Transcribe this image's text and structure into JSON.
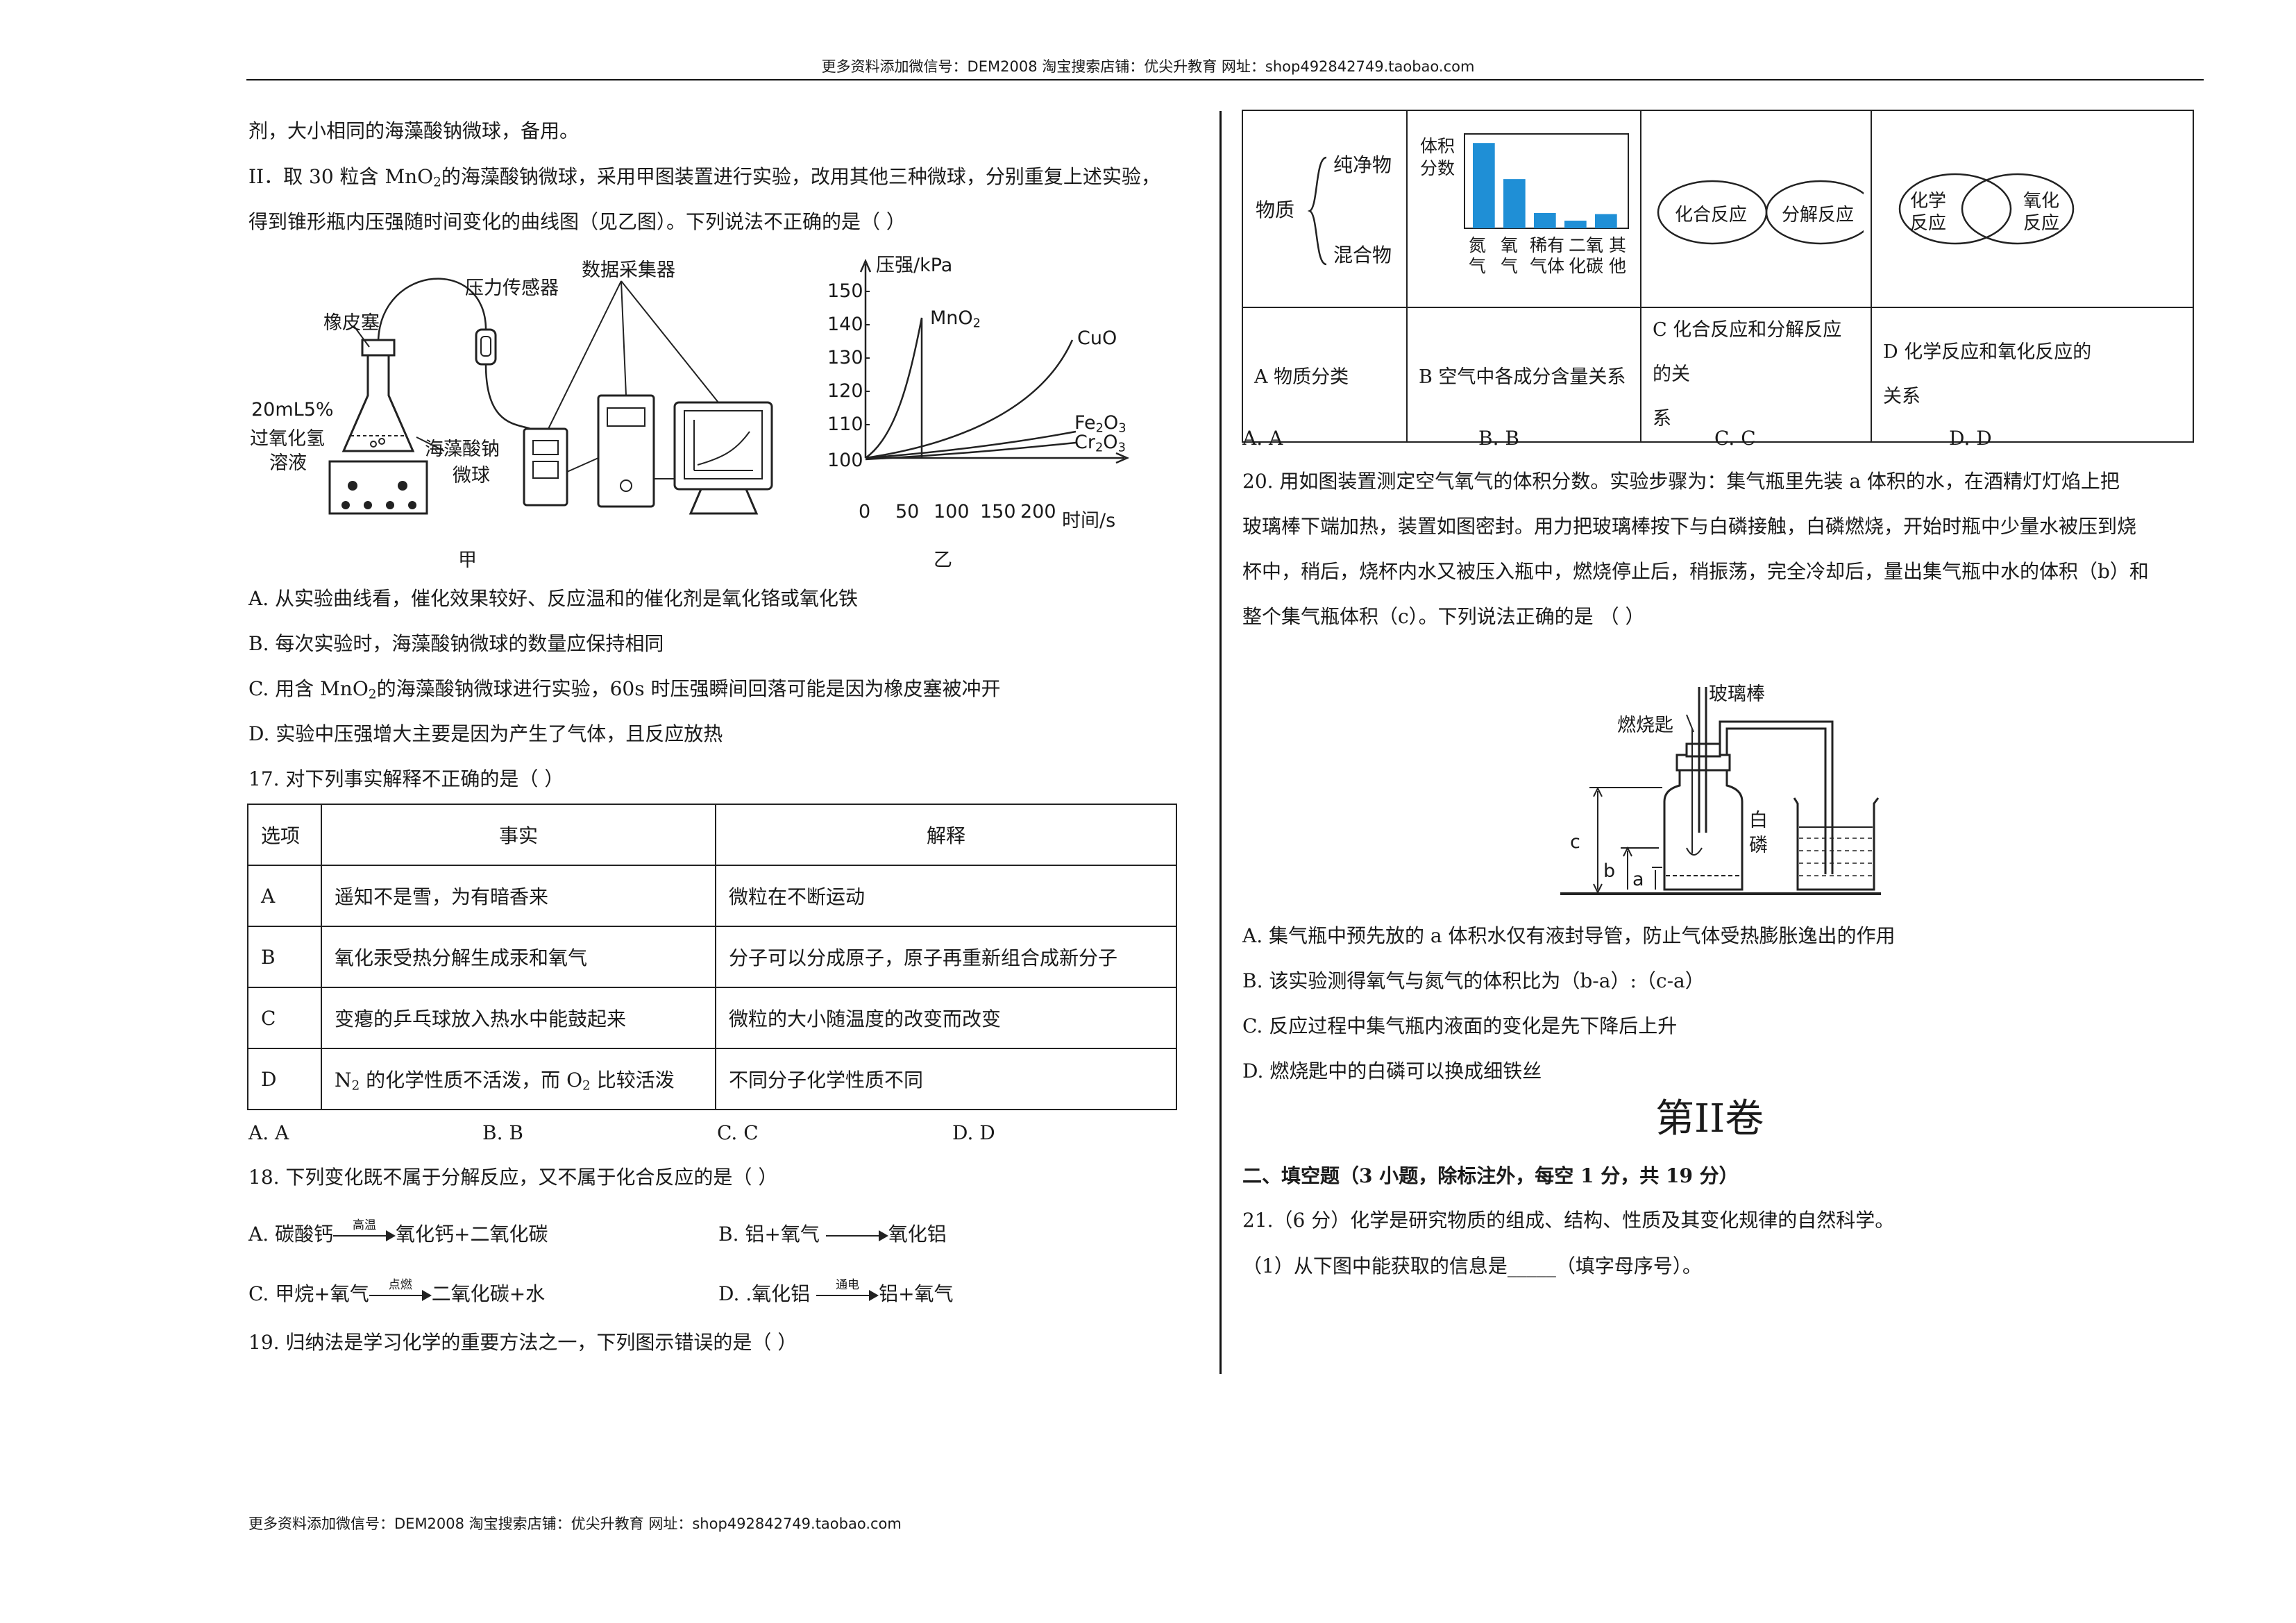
{
  "header": {
    "text": "更多资料添加微信号：DEM2008   淘宝搜索店铺：优尖升教育  网址：shop492842749.taobao.com"
  },
  "footer": {
    "text": "更多资料添加微信号：DEM2008   淘宝搜索店铺：优尖升教育  网址：shop492842749.taobao.com"
  },
  "left": {
    "cont_line": "剂，大小相同的海藻酸钠微球，备用。",
    "q16_step_a": "II．取 30 粒含 MnO",
    "q16_step_b": "的海藻酸钠微球，采用甲图装置进行实验，改用其他三种微球，分别重复上述实验，",
    "q16_step2": "得到锥形瓶内压强随时间变化的曲线图（见乙图）。下列说法不正确的是（      ）",
    "fig_jia": {
      "stopper": "橡皮塞",
      "sensor": "压力传感器",
      "collector": "数据采集器",
      "solution1": "20mL5%",
      "solution2": "过氧化氢",
      "solution3": "溶液",
      "beads1": "海藻酸钠",
      "beads2": "微球",
      "caption": "甲"
    },
    "fig_yi": {
      "ylabel": "压强/kPa",
      "xlabel": "时间/s",
      "yticks": [
        "150",
        "140",
        "130",
        "120",
        "110",
        "100"
      ],
      "xticks": [
        "0",
        "50",
        "100",
        "150",
        "200"
      ],
      "s1": "MnO",
      "s2": "CuO",
      "s3": "Fe",
      "s4": "Cr",
      "caption": "乙"
    },
    "q16_A": "A. 从实验曲线看，催化效果较好、反应温和的催化剂是氧化铬或氧化铁",
    "q16_B": "B. 每次实验时，海藻酸钠微球的数量应保持相同",
    "q16_C_a": "C. 用含 MnO",
    "q16_C_b": "的海藻酸钠微球进行实验，60s 时压强瞬间回落可能是因为橡皮塞被冲开",
    "q16_D": "D. 实验中压强增大主要是因为产生了气体，且反应放热",
    "q17": "17. 对下列事实解释不正确的是（      ）",
    "t17_h1": "选项",
    "t17_h2": "事实",
    "t17_h3": "解释",
    "t17_r1_1": "A",
    "t17_r1_2": "遥知不是雪，为有暗香来",
    "t17_r1_3": "微粒在不断运动",
    "t17_r2_1": "B",
    "t17_r2_2": "氧化汞受热分解生成汞和氧气",
    "t17_r2_3": "分子可以分成原子，原子再重新组合成新分子",
    "t17_r3_1": "C",
    "t17_r3_2": "变瘪的乒乓球放入热水中能鼓起来",
    "t17_r3_3": "微粒的大小随温度的改变而改变",
    "t17_r4_1": "D",
    "t17_r4_2a": "N",
    "t17_r4_2b": " 的化学性质不活泼，而 O",
    "t17_r4_2c": " 比较活泼",
    "t17_r4_3": "不同分子化学性质不同",
    "q17_opts": [
      "A. A",
      "B. B",
      "C. C",
      "D. D"
    ],
    "q18": "18. 下列变化既不属于分解反应，又不属于化合反应的是（         ）",
    "q18_A_a": "A. 碳酸钙",
    "q18_A_c": "高温",
    "q18_A_b": "氧化钙+二氧化碳",
    "q18_B_a": "B. 铝+氧气",
    "q18_B_b": "氧化铝",
    "q18_C_a": "C. 甲烷+氧气",
    "q18_C_c": "点燃",
    "q18_C_b": "二氧化碳+水",
    "q18_D_a": "D. .氧化铝",
    "q18_D_c": "通电",
    "q18_D_b": "铝+氧气",
    "q19": "19. 归纳法是学习化学的重要方法之一，下列图示错误的是（      ）"
  },
  "right": {
    "t19": {
      "a_label": "物质",
      "a_pure": "纯净物",
      "a_mix": "混合物",
      "b_ylabel1": "体积",
      "b_ylabel2": "分数",
      "b_cats": [
        "氮气",
        "氧气",
        "稀有气体",
        "二氧化碳",
        "其他"
      ],
      "b_values": [
        78,
        45,
        14,
        7,
        13
      ],
      "c_left": "化合反应",
      "c_right": "分解反应",
      "d_left1": "化学",
      "d_left2": "反应",
      "d_right1": "氧化",
      "d_right2": "反应",
      "row2_a": "A 物质分类",
      "row2_b": "B 空气中各成分含量关系",
      "row2_c1": "C 化合反应和分解反应的关",
      "row2_c2": "系",
      "row2_d1": "D 化学反应和氧化反应的",
      "row2_d2": "关系"
    },
    "q19_opts": [
      "A. A",
      "B. B",
      "C. C",
      "D. D"
    ],
    "q20_l1": "20. 用如图装置测定空气氧气的体积分数。实验步骤为：集气瓶里先装 a 体积的水，在酒精灯灯焰上把",
    "q20_l2": "玻璃棒下端加热，装置如图密封。用力把玻璃棒按下与白磷接触，白磷燃烧，开始时瓶中少量水被压到烧",
    "q20_l3": "杯中，稍后，烧杯内水又被压入瓶中，燃烧停止后，稍振荡，完全冷却后，量出集气瓶中水的体积（b）和",
    "q20_l4": "整个集气瓶体积（c）。下列说法正确的是 （      ）",
    "fig20": {
      "rod": "玻璃棒",
      "spoon": "燃烧匙",
      "p1": "白",
      "p2": "磷",
      "c": "c",
      "b": "b",
      "a": "a"
    },
    "q20_A": "A. 集气瓶中预先放的 a 体积水仅有液封导管，防止气体受热膨胀逸出的作用",
    "q20_B": "B. 该实验测得氧气与氮气的体积比为（b-a）:（c-a）",
    "q20_C": "C. 反应过程中集气瓶内液面的变化是先下降后上升",
    "q20_D": "D. 燃烧匙中的白磷可以换成细铁丝",
    "vol2": "第II卷",
    "sec2": "二、填空题（3 小题，除标注外，每空 1 分，共 19 分）",
    "q21": "21.（6 分）化学是研究物质的组成、结构、性质及其变化规律的自然科学。",
    "q21_1": "（1）从下图中能获取的信息是_____（填字母序号）。"
  }
}
